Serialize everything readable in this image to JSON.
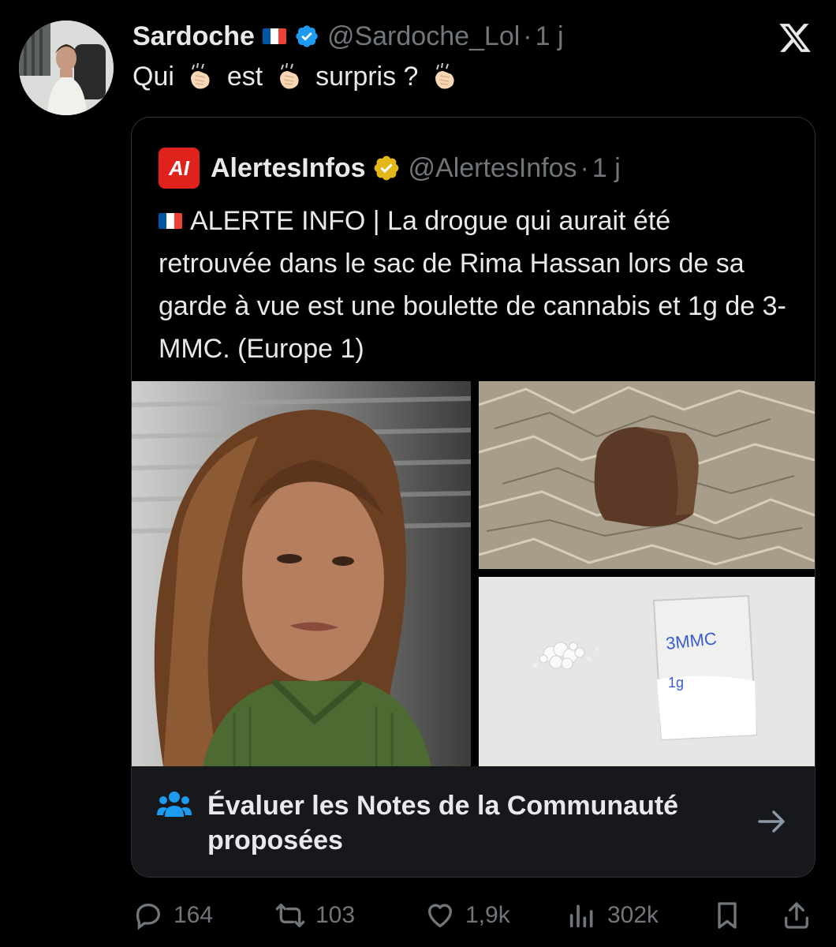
{
  "tweet": {
    "author_name": "Sardoche",
    "author_handle": "@Sardoche_Lol",
    "separator": "·",
    "time": "1 j",
    "text_parts": [
      "Qui",
      "est",
      "surpris ?"
    ],
    "icons": {
      "flag": "french-flag-icon",
      "verified": "verified-badge-icon",
      "clap": "clapping-hands-emoji",
      "logo": "x-logo-icon"
    }
  },
  "quote": {
    "author_name": "AlertesInfos",
    "author_handle": "@AlertesInfos",
    "separator": "·",
    "time": "1 j",
    "logo_text": "AI",
    "text": "ALERTE INFO | La drogue qui aurait été retrouvée dans le sac de Rima Hassan lors de sa garde à vue est une boulette de cannabis et 1g de 3-MMC. (Europe 1)",
    "powder_label_1": "3MMC",
    "powder_label_2": "1g"
  },
  "community_notes": {
    "line1": "Évaluer les Notes de la Communauté",
    "line2": "proposées"
  },
  "actions": {
    "replies": "164",
    "reposts": "103",
    "likes": "1,9k",
    "views": "302k"
  },
  "colors": {
    "background": "#000000",
    "text": "#e7e9ea",
    "muted": "#71767b",
    "verified_blue": "#1d9bf0",
    "verified_gold": "#e2b719",
    "brand_red": "#e0221c",
    "notes_bg": "#16181c",
    "notes_icon": "#1d9bf0"
  }
}
